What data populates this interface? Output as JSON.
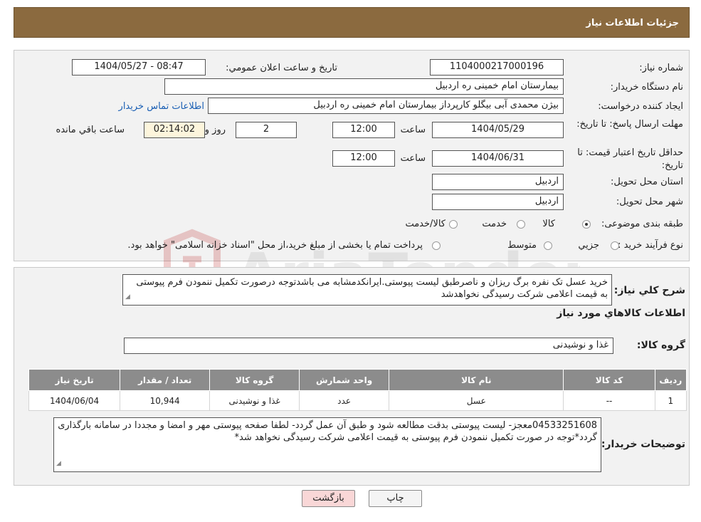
{
  "header": {
    "title": "جزئیات اطلاعات نیاز"
  },
  "labels": {
    "need_number": "شماره نیاز:",
    "announce_datetime": "تاریخ و ساعت اعلان عمومي:",
    "buyer_org": "نام دستگاه خریدار:",
    "requester": "ایجاد کننده درخواست:",
    "contact_link": "اطلاعات تماس خریدار",
    "reply_deadline": "مهلت ارسال پاسخ: تا تاریخ:",
    "time_word": "ساعت",
    "day_and": "روز و",
    "remaining": "ساعت باقي مانده",
    "price_validity": "حداقل تاریخ اعتبار قیمت: تا تاریخ:",
    "province": "استان محل تحویل:",
    "city": "شهر محل تحویل:",
    "category": "طبقه بندی موضوعی:",
    "purchase_type": "نوع فرآیند خرید :",
    "description": "شرح کلي نیاز:",
    "goods_info": "اطلاعات کالاهاي مورد نیاز",
    "goods_group": "گروه کالا:",
    "buyer_notes": "توضیحات خریدار:"
  },
  "values": {
    "need_number": "1104000217000196",
    "announce_datetime": "1404/05/27 - 08:47",
    "buyer_org": "بیمارستان امام خمینی  ره  اردبیل",
    "requester": "بیژن محمدی آبی بیگلو کارپرداز بیمارستان امام خمینی  ره  اردبیل",
    "reply_date": "1404/05/29",
    "reply_time": "12:00",
    "days": "2",
    "remaining_time": "02:14:02",
    "validity_date": "1404/06/31",
    "validity_time": "12:00",
    "province": "اردبیل",
    "city": "اردبیل",
    "goods_group": "غذا و نوشیدنی"
  },
  "category_options": [
    {
      "label": "کالا",
      "selected": true
    },
    {
      "label": "خدمت",
      "selected": false
    },
    {
      "label": "کالا/خدمت",
      "selected": false
    }
  ],
  "purchase_options": [
    {
      "label": "جزیي",
      "selected": false
    },
    {
      "label": "متوسط",
      "selected": false
    }
  ],
  "purchase_note": "پرداخت تمام یا بخشی از مبلغ خرید،از محل \"اسناد خزانه اسلامی\" خواهد بود.",
  "description_text": "خرید عسل تک نفره برگ ریزان و ناصرطبق لیست پیوستی.ایرانکدمشابه می باشدتوجه درصورت تکمیل ننمودن فرم پیوستی به قیمت اعلامی شرکت رسیدگی نخواهدشد",
  "table": {
    "headers": [
      "ردیف",
      "کد کالا",
      "نام کالا",
      "واحد شمارش",
      "گروه کالا",
      "تعداد / مقدار",
      "تاریخ نیاز"
    ],
    "rows": [
      [
        "1",
        "--",
        "عسل",
        "عدد",
        "غذا و نوشیدنی",
        "10,944",
        "1404/06/04"
      ]
    ]
  },
  "buyer_notes_text": "04533251608معجز- لیست پیوستی بدقت مطالعه شود و طبق آن عمل گردد- لطفا صفحه پیوستی مهر و امضا و مجددا در سامانه بارگذاری گردد*توجه در صورت تکمیل ننمودن فرم پیوستی به قیمت اعلامی شرکت رسیدگی نخواهد شد*",
  "buttons": {
    "print": "چاپ",
    "back": "بازگشت"
  },
  "watermark_text": "AriaTender.neT",
  "colors": {
    "header": "#8b6a3f",
    "back_button": "#f9d7d7",
    "link": "#1a5fb4"
  }
}
